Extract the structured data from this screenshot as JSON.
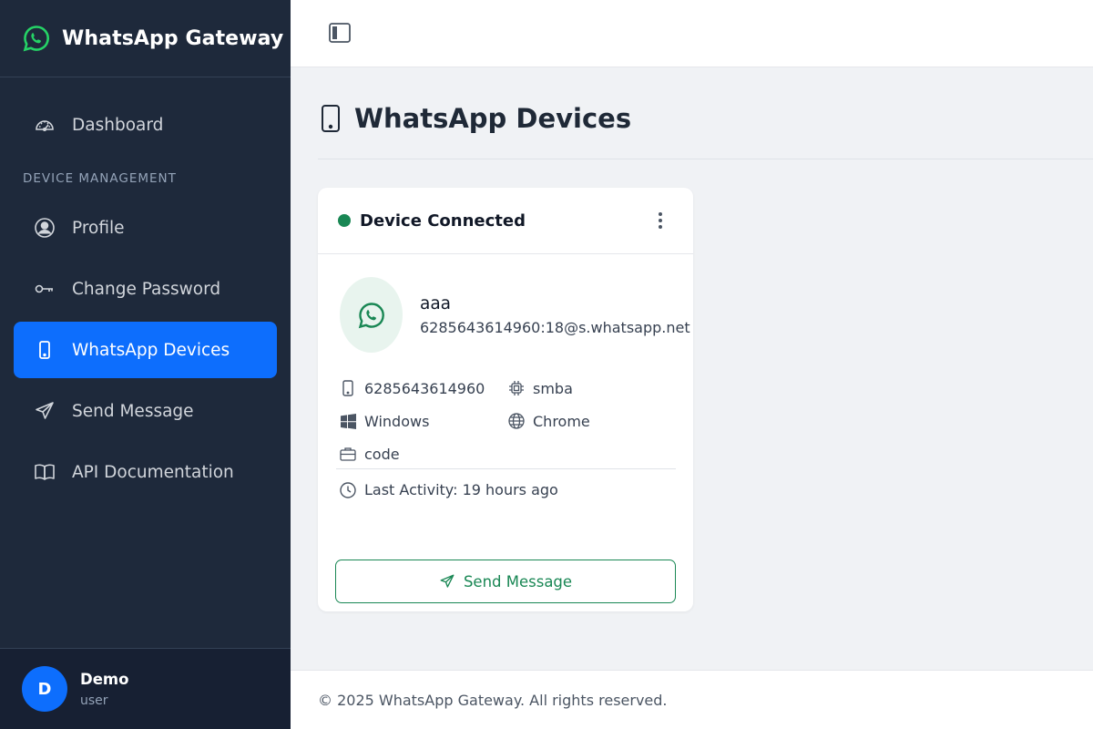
{
  "app": {
    "title": "WhatsApp Gateway"
  },
  "colors": {
    "sidebar_bg": "#1e293b",
    "accent": "#0d6efd",
    "success": "#198754",
    "brand_green": "#25d366"
  },
  "sidebar": {
    "items": [
      {
        "label": "Dashboard",
        "icon": "speedometer-icon",
        "active": false
      },
      {
        "label": "Profile",
        "icon": "user-circle-icon",
        "active": false
      },
      {
        "label": "Change Password",
        "icon": "key-icon",
        "active": false
      },
      {
        "label": "WhatsApp Devices",
        "icon": "phone-icon",
        "active": true
      },
      {
        "label": "Send Message",
        "icon": "send-icon",
        "active": false
      },
      {
        "label": "API Documentation",
        "icon": "book-icon",
        "active": false
      }
    ],
    "section_label": "DEVICE MANAGEMENT",
    "user": {
      "initial": "D",
      "name": "Demo",
      "role": "user"
    }
  },
  "page": {
    "title": "WhatsApp Devices",
    "title_icon": "phone-icon"
  },
  "device_card": {
    "status": "Device Connected",
    "name": "aaa",
    "jid": "6285643614960:18@s.whatsapp.net",
    "details": {
      "phone": "6285643614960",
      "platform_code": "smba",
      "os": "Windows",
      "browser": "Chrome",
      "business": "code"
    },
    "last_activity": "Last Activity: 19 hours ago",
    "send_button": "Send Message"
  },
  "footer": {
    "text": "© 2025 WhatsApp Gateway. All rights reserved."
  }
}
